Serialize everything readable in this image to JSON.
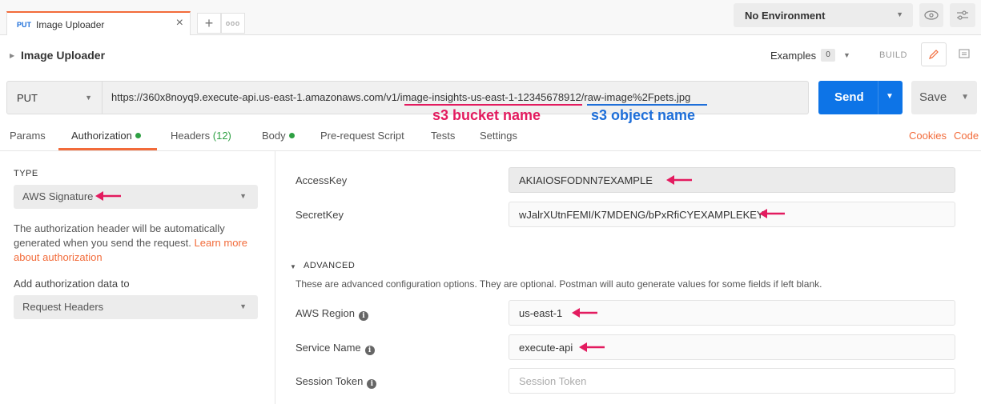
{
  "tabs": {
    "method": "PUT",
    "name": "Image Uploader",
    "close": "✕",
    "plus": "+",
    "more": "ooo"
  },
  "environment": {
    "label": "No Environment"
  },
  "request": {
    "title": "Image Uploader",
    "examples_label": "Examples",
    "examples_count": "0",
    "build_label": "BUILD"
  },
  "url_bar": {
    "method": "PUT",
    "url": "https://360x8noyq9.execute-api.us-east-1.amazonaws.com/v1/image-insights-us-east-1-12345678912/raw-image%2Fpets.jpg",
    "send_label": "Send",
    "save_label": "Save"
  },
  "annotations": {
    "bucket": "s3 bucket name",
    "object": "s3 object name",
    "arrow_color": "#e31b5f"
  },
  "subtabs": {
    "params": "Params",
    "authorization": "Authorization",
    "headers": "Headers",
    "headers_count": "(12)",
    "body": "Body",
    "prerequest": "Pre-request Script",
    "tests": "Tests",
    "settings": "Settings",
    "cookies": "Cookies",
    "code": "Code"
  },
  "auth": {
    "type_label": "TYPE",
    "type_value": "AWS Signature",
    "desc_text": "The authorization header will be automatically generated when you send the request.",
    "desc_link": "Learn more about authorization",
    "add_label": "Add authorization data to",
    "add_value": "Request Headers"
  },
  "fields": {
    "access_key_label": "AccessKey",
    "access_key_value": "AKIAIOSFODNN7EXAMPLE",
    "secret_key_label": "SecretKey",
    "secret_key_value": "wJalrXUtnFEMI/K7MDENG/bPxRfiCYEXAMPLEKEY",
    "advanced_label": "ADVANCED",
    "advanced_desc": "These are advanced configuration options. They are optional. Postman will auto generate values for some fields if left blank.",
    "region_label": "AWS Region",
    "region_value": "us-east-1",
    "service_label": "Service Name",
    "service_value": "execute-api",
    "session_label": "Session Token",
    "session_placeholder": "Session Token"
  },
  "colors": {
    "accent": "#f26b3a",
    "send": "#0d74e7",
    "green": "#2ea043"
  }
}
